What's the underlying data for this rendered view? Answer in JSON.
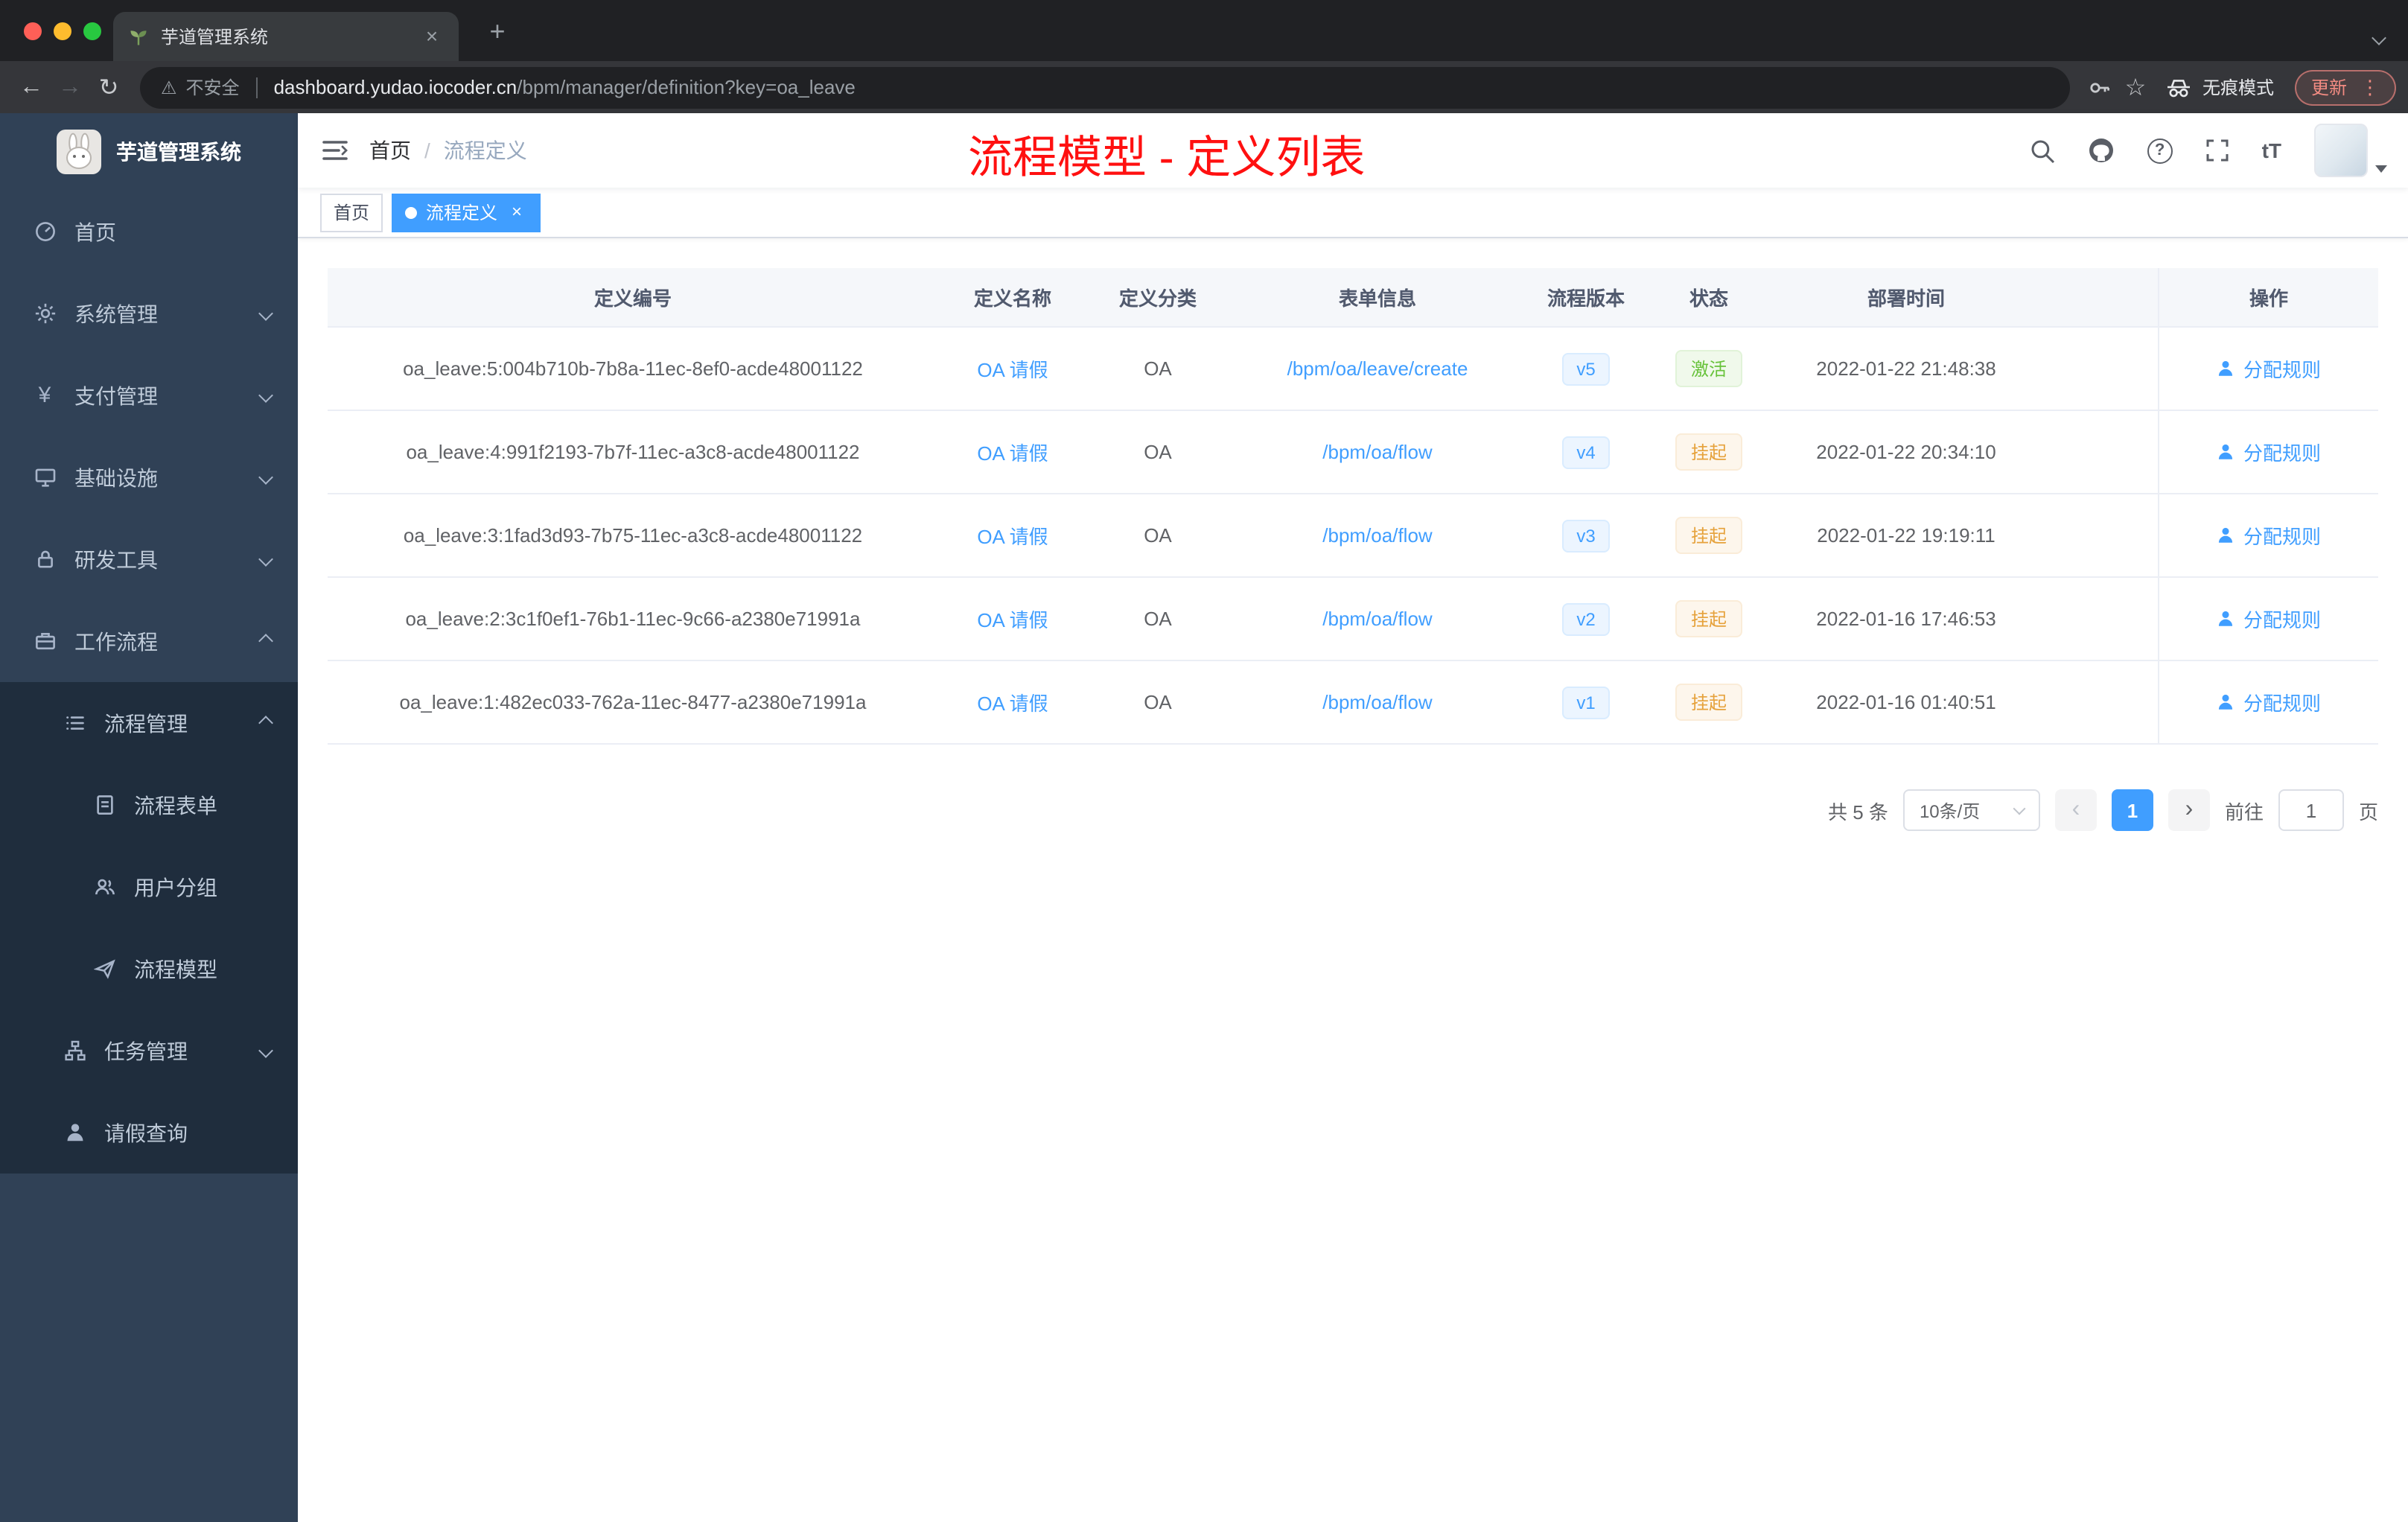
{
  "browser": {
    "tab_title": "芋道管理系统",
    "security_label": "不安全",
    "url_host": "dashboard.yudao.iocoder.cn",
    "url_path": "/bpm/manager/definition?key=oa_leave",
    "incognito_label": "无痕模式",
    "update_label": "更新"
  },
  "icons": {
    "back": "←",
    "forward": "→",
    "reload": "↻",
    "star": "☆",
    "new_tab": "+",
    "close": "×",
    "warning": "⚠",
    "overflow_menu": "⋮",
    "help": "?",
    "font_size": "tT",
    "yen": "¥",
    "prev": "‹",
    "next": "›"
  },
  "sidebar": {
    "logo_title": "芋道管理系统",
    "items": [
      {
        "label": "首页"
      },
      {
        "label": "系统管理"
      },
      {
        "label": "支付管理"
      },
      {
        "label": "基础设施"
      },
      {
        "label": "研发工具"
      },
      {
        "label": "工作流程"
      },
      {
        "label": "流程管理"
      },
      {
        "label": "流程表单"
      },
      {
        "label": "用户分组"
      },
      {
        "label": "流程模型"
      },
      {
        "label": "任务管理"
      },
      {
        "label": "请假查询"
      }
    ]
  },
  "header": {
    "breadcrumb_home": "首页",
    "breadcrumb_separator": "/",
    "breadcrumb_current": "流程定义",
    "annotation": "流程模型 - 定义列表"
  },
  "tags": [
    {
      "label": "首页"
    },
    {
      "label": "流程定义"
    }
  ],
  "table": {
    "columns": [
      "定义编号",
      "定义名称",
      "定义分类",
      "表单信息",
      "流程版本",
      "状态",
      "部署时间",
      "操作"
    ],
    "rows": [
      {
        "id": "oa_leave:5:004b710b-7b8a-11ec-8ef0-acde48001122",
        "name": "OA 请假",
        "category": "OA",
        "form": "/bpm/oa/leave/create",
        "version": "v5",
        "status": "激活",
        "time": "2022-01-22 21:48:38",
        "action": "分配规则"
      },
      {
        "id": "oa_leave:4:991f2193-7b7f-11ec-a3c8-acde48001122",
        "name": "OA 请假",
        "category": "OA",
        "form": "/bpm/oa/flow",
        "version": "v4",
        "status": "挂起",
        "time": "2022-01-22 20:34:10",
        "action": "分配规则"
      },
      {
        "id": "oa_leave:3:1fad3d93-7b75-11ec-a3c8-acde48001122",
        "name": "OA 请假",
        "category": "OA",
        "form": "/bpm/oa/flow",
        "version": "v3",
        "status": "挂起",
        "time": "2022-01-22 19:19:11",
        "action": "分配规则"
      },
      {
        "id": "oa_leave:2:3c1f0ef1-76b1-11ec-9c66-a2380e71991a",
        "name": "OA 请假",
        "category": "OA",
        "form": "/bpm/oa/flow",
        "version": "v2",
        "status": "挂起",
        "time": "2022-01-16 17:46:53",
        "action": "分配规则"
      },
      {
        "id": "oa_leave:1:482ec033-762a-11ec-8477-a2380e71991a",
        "name": "OA 请假",
        "category": "OA",
        "form": "/bpm/oa/flow",
        "version": "v1",
        "status": "挂起",
        "time": "2022-01-16 01:40:51",
        "action": "分配规则"
      }
    ]
  },
  "pagination": {
    "total": "共 5 条",
    "page_size": "10条/页",
    "current_page": "1",
    "goto_label": "前往",
    "goto_value": "1",
    "page_unit": "页"
  },
  "colors": {
    "accent": "#409eff",
    "success": "#67c23a",
    "warning": "#e6a23c",
    "annotation_red": "#ff1010",
    "sidebar_bg": "#304156",
    "submenu_bg": "#1f2d3d"
  }
}
